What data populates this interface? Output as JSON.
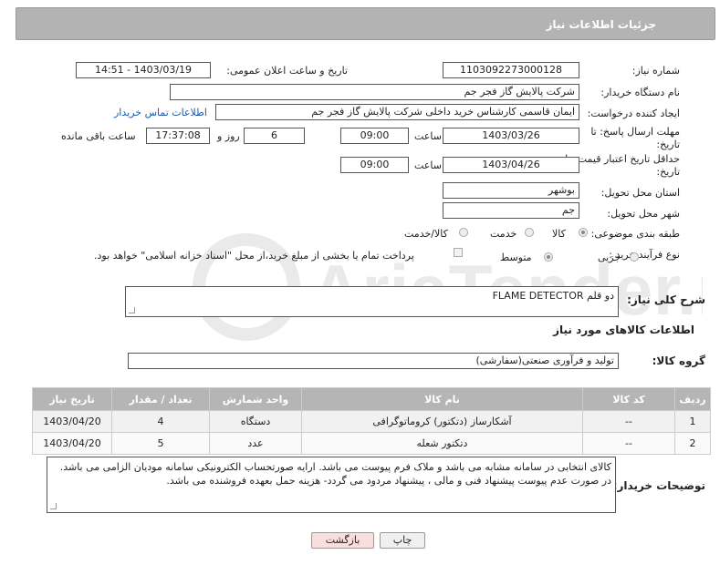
{
  "header": {
    "title": "جزئیات اطلاعات نیاز"
  },
  "fields": {
    "need_number_label": "شماره نیاز:",
    "need_number": "1103092273000128",
    "announce_label": "تاریخ و ساعت اعلان عمومی:",
    "announce_value": "1403/03/19 - 14:51",
    "buyer_org_label": "نام دستگاه خریدار:",
    "buyer_org": "شرکت پالایش گاز فجر جم",
    "creator_label": "ایجاد کننده درخواست:",
    "creator": "ایمان قاسمی کارشناس خرید داخلی شرکت پالایش گاز فجر جم",
    "contact_link": "اطلاعات تماس خریدار",
    "deadline_label_1": "مهلت ارسال پاسخ: تا",
    "deadline_label_2": "تاریخ:",
    "deadline_date": "1403/03/26",
    "time_label": "ساعت",
    "deadline_time": "09:00",
    "days_value": "6",
    "days_label": "روز و",
    "remaining_time": "17:37:08",
    "remaining_label": "ساعت باقی مانده",
    "validity_label_1": "حداقل تاریخ اعتبار قیمت: تا",
    "validity_label_2": "تاریخ:",
    "validity_date": "1403/04/26",
    "validity_time": "09:00",
    "province_label": "استان محل تحویل:",
    "province": "بوشهر",
    "city_label": "شهر محل تحویل:",
    "city": "جم",
    "category_label": "طبقه بندی موضوعی:",
    "category_options": [
      "کالا",
      "خدمت",
      "کالا/خدمت"
    ],
    "process_label": "نوع فرآیند خرید :",
    "process_options": [
      "جزیی",
      "متوسط"
    ],
    "payment_note": "پرداخت تمام یا بخشی از مبلغ خرید،از محل \"اسناد خزانه اسلامی\" خواهد بود.",
    "summary_label": "شرح کلی نیاز:",
    "summary": "دو قلم FLAME DETECTOR",
    "goods_info_title": "اطلاعات کالاهای مورد نیاز",
    "goods_group_label": "گروه کالا:",
    "goods_group": "تولید و فرآوری صنعتی(سفارشی)"
  },
  "table": {
    "headers": [
      "ردیف",
      "کد کالا",
      "نام کالا",
      "واحد شمارش",
      "تعداد / مقدار",
      "تاریخ نیاز"
    ],
    "rows": [
      [
        "1",
        "--",
        "آشکارساز (دتکتور) کروماتوگرافی",
        "دستگاه",
        "4",
        "1403/04/20"
      ],
      [
        "2",
        "--",
        "دتکتور شعله",
        "عدد",
        "5",
        "1403/04/20"
      ]
    ]
  },
  "buyer_notes_label": "توضیحات خریدار:",
  "buyer_notes": "کالای انتخابی در سامانه مشابه می باشد و ملاک فرم پیوست می باشد.  ارایه صورتحساب الکترونیکی سامانه مودیان الزامی می باشد. در صورت عدم پیوست پیشنهاد فنی و مالی ، پیشنهاد مردود می گردد- هزینه حمل بعهده فروشنده می باشد.",
  "buttons": {
    "print": "چاپ",
    "back": "بازگشت"
  },
  "watermark": "AriaTender.net",
  "colors": {
    "header_bg": "#b3b3b3",
    "link": "#1a5bb0",
    "back_button_bg": "#f9dede"
  }
}
